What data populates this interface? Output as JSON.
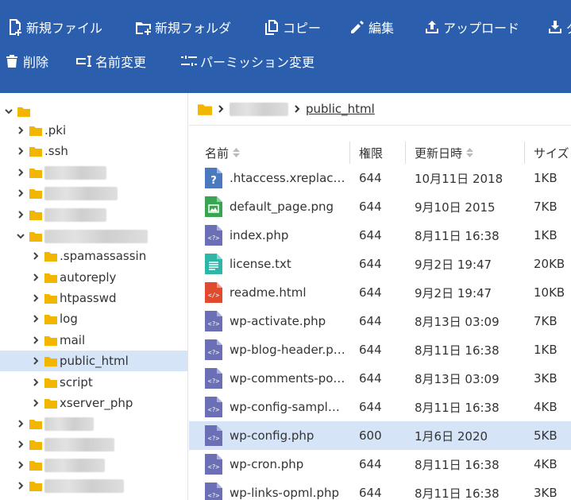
{
  "toolbar": {
    "new_file": "新規ファイル",
    "new_folder": "新規フォルダ",
    "copy": "コピー",
    "edit": "編集",
    "upload": "アップロード",
    "download_partial": "ダ",
    "delete": "削除",
    "rename": "名前変更",
    "permission": "パーミッション変更"
  },
  "breadcrumb": {
    "current": "public_html"
  },
  "tree": {
    "items": [
      {
        "label": ".pki"
      },
      {
        "label": ".ssh"
      },
      {
        "label": ".spamassassin"
      },
      {
        "label": "autoreply"
      },
      {
        "label": "htpasswd"
      },
      {
        "label": "log"
      },
      {
        "label": "mail"
      },
      {
        "label": "public_html"
      },
      {
        "label": "script"
      },
      {
        "label": "xserver_php"
      }
    ]
  },
  "table": {
    "columns": [
      "名前",
      "権限",
      "更新日時",
      "サイズ"
    ],
    "rows": [
      {
        "name": ".htaccess.xreplac…",
        "perm": "644",
        "date": "10月11日 2018",
        "size": "1KB",
        "icon": "unknown-file-icon",
        "color": "#4a79c0"
      },
      {
        "name": "default_page.png",
        "perm": "644",
        "date": "9月10日 2015",
        "size": "7KB",
        "icon": "image-file-icon",
        "color": "#3aa550"
      },
      {
        "name": "index.php",
        "perm": "644",
        "date": "8月11日 16:38",
        "size": "1KB",
        "icon": "php-file-icon",
        "color": "#6b6fb5"
      },
      {
        "name": "license.txt",
        "perm": "644",
        "date": "9月2日 19:47",
        "size": "20KB",
        "icon": "text-file-icon",
        "color": "#2fb6a8"
      },
      {
        "name": "readme.html",
        "perm": "644",
        "date": "9月2日 19:47",
        "size": "10KB",
        "icon": "html-file-icon",
        "color": "#e04b2e"
      },
      {
        "name": "wp-activate.php",
        "perm": "644",
        "date": "8月13日 03:09",
        "size": "7KB",
        "icon": "php-file-icon",
        "color": "#6b6fb5"
      },
      {
        "name": "wp-blog-header.p…",
        "perm": "644",
        "date": "8月11日 16:38",
        "size": "1KB",
        "icon": "php-file-icon",
        "color": "#6b6fb5"
      },
      {
        "name": "wp-comments-po…",
        "perm": "644",
        "date": "8月13日 03:09",
        "size": "3KB",
        "icon": "php-file-icon",
        "color": "#6b6fb5"
      },
      {
        "name": "wp-config-sampl…",
        "perm": "644",
        "date": "8月11日 16:38",
        "size": "4KB",
        "icon": "php-file-icon",
        "color": "#6b6fb5"
      },
      {
        "name": "wp-config.php",
        "perm": "600",
        "date": "1月6日 2020",
        "size": "5KB",
        "icon": "php-file-icon",
        "color": "#6b6fb5"
      },
      {
        "name": "wp-cron.php",
        "perm": "644",
        "date": "8月11日 16:38",
        "size": "4KB",
        "icon": "php-file-icon",
        "color": "#6b6fb5"
      },
      {
        "name": "wp-links-opml.php",
        "perm": "644",
        "date": "8月11日 16:38",
        "size": "3KB",
        "icon": "php-file-icon",
        "color": "#6b6fb5"
      }
    ]
  },
  "colors": {
    "toolbar_bg": "#2b5fae",
    "folder": "#f2b600",
    "selected_bg": "#d6e4f7"
  }
}
